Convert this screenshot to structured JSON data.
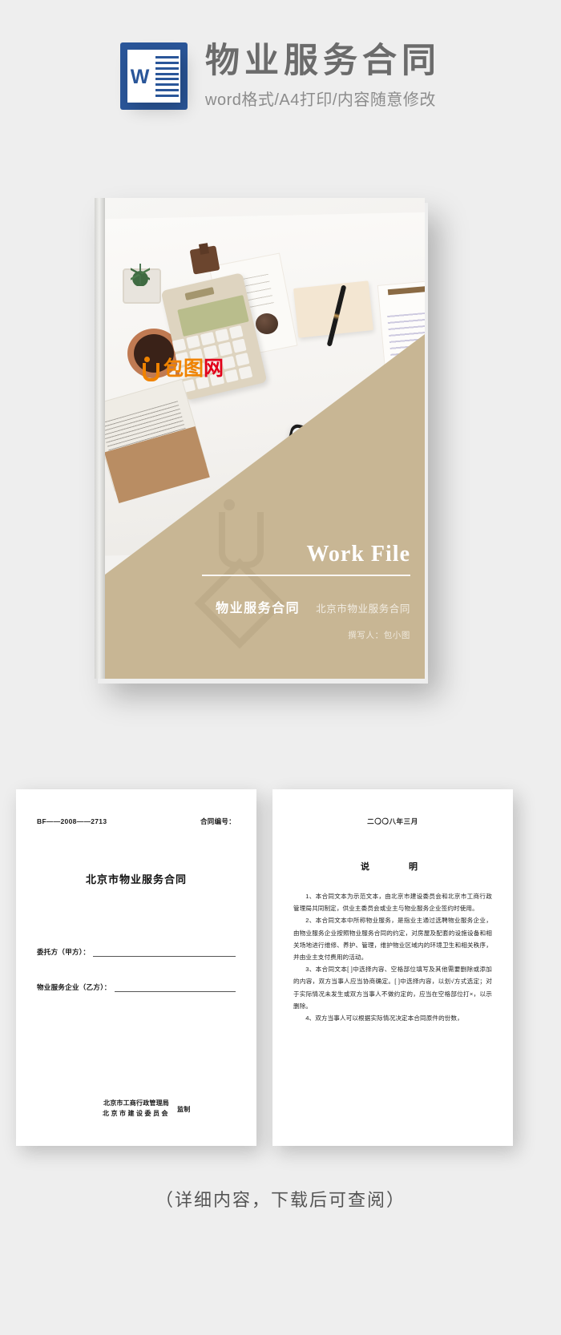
{
  "header": {
    "icon_name": "word-document-icon",
    "icon_letter": "W",
    "title": "物业服务合同",
    "subtitle": "word格式/A4打印/内容随意修改"
  },
  "cover": {
    "brand_mark": "baotu-logo-icon",
    "brand_text_1": "包",
    "brand_text_2": "图",
    "brand_text_3": "网",
    "work_file": "Work File",
    "title_main": "物业服务合同",
    "title_sub": "北京市物业服务合同",
    "author": "撰写人：包小图",
    "tan_color": "#c8b694",
    "brand_color": "#f08300"
  },
  "page_left": {
    "code": "BF——2008——2713",
    "contract_no_label": "合同编号：",
    "title": "北京市物业服务合同",
    "field_party_a": "委托方（甲方）：",
    "field_party_b": "物业服务企业（乙方）：",
    "footer_line1": "北京市工商行政管理局",
    "footer_seal": "监制",
    "footer_line2": "北京市建设委员会"
  },
  "page_right": {
    "date": "二〇〇八年三月",
    "note_title": "说　　明",
    "paragraphs": [
      "1、本合同文本为示范文本，由北京市建设委员会和北京市工商行政管理局共同制定，供业主委员会或业主与物业服务企业签约时使用。",
      "2、本合同文本中所称物业服务，是指业主通过选聘物业服务企业，由物业服务企业按照物业服务合同的约定，对房屋及配套的设施设备和相关场地进行维修、养护、管理，维护物业区域内的环境卫生和相关秩序，并由业主支付费用的活动。",
      "3、本合同文本[ ]中选择内容、空格部位填写及其他需要删除或添加的内容，双方当事人应当协商确定。[ ]中选择内容，以划√方式选定；对于实际情况未发生或双方当事人不做约定的，应当在空格部位打×，以示删除。",
      "4、双方当事人可以根据实际情况决定本合同原件的份数，"
    ]
  },
  "footer": {
    "note": "（详细内容，下载后可查阅）"
  }
}
